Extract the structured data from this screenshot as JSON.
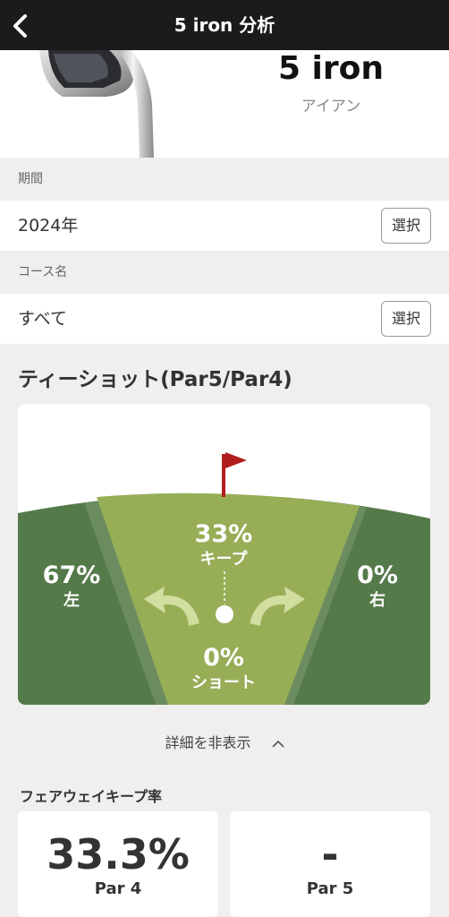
{
  "header": {
    "title": "5 iron 分析"
  },
  "club": {
    "name": "5 iron",
    "type": "アイアン"
  },
  "filters": [
    {
      "label": "期間",
      "value": "2024年",
      "button": "選択"
    },
    {
      "label": "コース名",
      "value": "すべて",
      "button": "選択"
    }
  ],
  "tee_shot": {
    "title": "ティーショット(Par5/Par4)",
    "keep": {
      "pct": "33%",
      "label": "キープ"
    },
    "left": {
      "pct": "67%",
      "label": "左"
    },
    "right": {
      "pct": "0%",
      "label": "右"
    },
    "short": {
      "pct": "0%",
      "label": "ショート"
    }
  },
  "details_toggle": "詳細を非表示",
  "fairway_keep": {
    "title": "フェアウェイキープ率",
    "cards": [
      {
        "value": "33.3%",
        "label": "Par 4"
      },
      {
        "value": "-",
        "label": "Par 5"
      }
    ]
  },
  "colors": {
    "topbar": "#1b1b1b",
    "rough": "#557a4a",
    "rough_edge": "#6b8c5f",
    "fairway": "#97ae57",
    "flag": "#b01e1e",
    "arrow": "#d1dea0"
  }
}
